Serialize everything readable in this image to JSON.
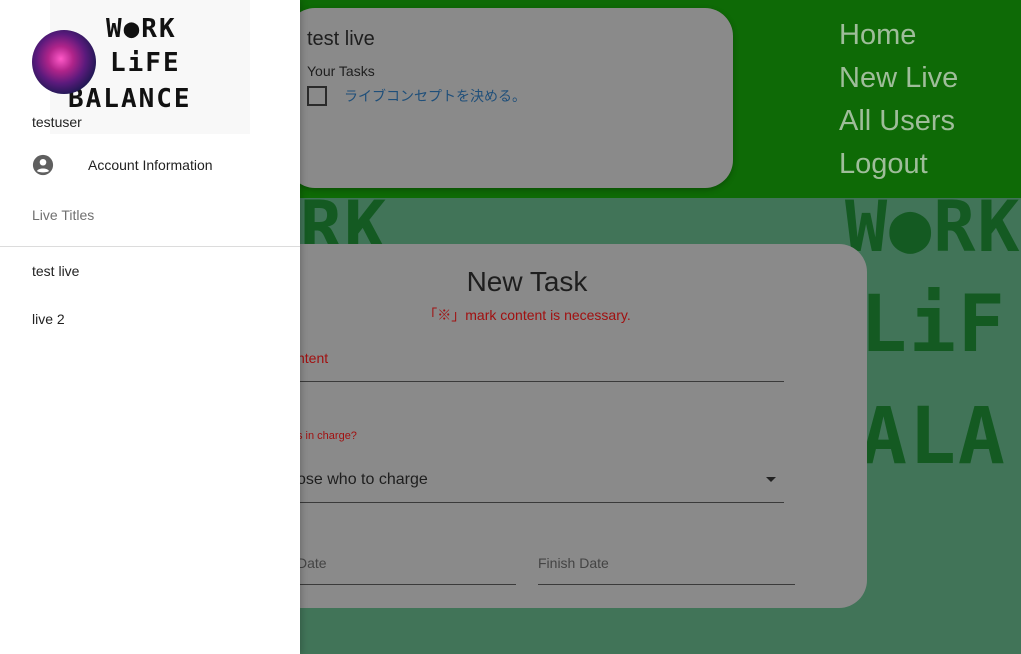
{
  "nav": {
    "items": [
      "Home",
      "New Live",
      "All Users",
      "Logout"
    ]
  },
  "live_card": {
    "title": "test live",
    "your_tasks_label": "Your Tasks",
    "tasks": [
      "ライブコンセプトを決める。"
    ]
  },
  "new_task": {
    "title": "New Task",
    "note": "「※」mark content is necessary.",
    "content_label": "ntent",
    "charge_label": "s in charge?",
    "charge_value": "ose who to charge",
    "start_label": "Date",
    "finish_label": "Finish Date"
  },
  "background_logo": {
    "line1": "RK",
    "line2": "W●RK",
    "line3": "LiF",
    "line4": "ALA"
  },
  "drawer": {
    "logo": {
      "line1": "W●RK",
      "line2": "LiFE",
      "line3": "BALANCE"
    },
    "username": "testuser",
    "account_label": "Account Information",
    "live_titles_label": "Live Titles",
    "lives": [
      "test live",
      "live 2"
    ]
  },
  "colors": {
    "header_green": "#0e6a06",
    "background_green": "#417458",
    "card_gray": "#8a8a8a",
    "error_red": "#a11010"
  }
}
